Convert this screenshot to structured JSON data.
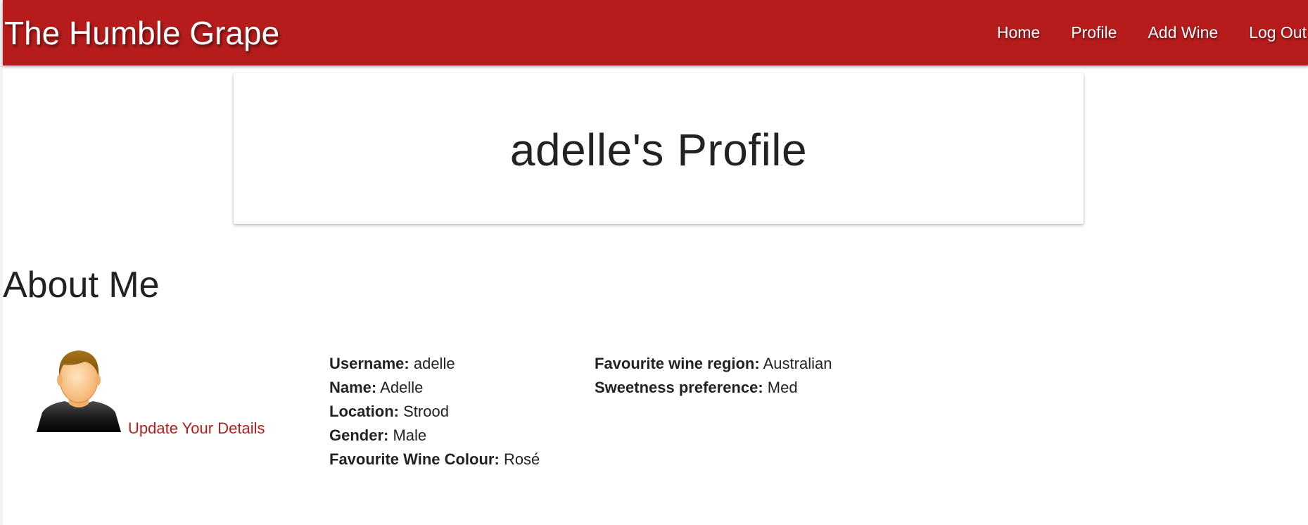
{
  "navbar": {
    "brand": "The Humble Grape",
    "links": [
      "Home",
      "Profile",
      "Add Wine",
      "Log Out"
    ]
  },
  "jumbotron": {
    "title": "adelle's Profile"
  },
  "about": {
    "title": "About Me",
    "update_link": "Update Your Details",
    "avatar_icon": "user-avatar-icon",
    "details_left": [
      {
        "label": "Username:",
        "value": "adelle"
      },
      {
        "label": "Name:",
        "value": "Adelle"
      },
      {
        "label": "Location:",
        "value": "Strood"
      },
      {
        "label": "Gender:",
        "value": "Male"
      },
      {
        "label": "Favourite Wine Colour:",
        "value": "Rosé"
      }
    ],
    "details_right": [
      {
        "label": "Favourite wine region:",
        "value": "Australian"
      },
      {
        "label": "Sweetness preference:",
        "value": "Med"
      }
    ]
  },
  "colors": {
    "brand_red": "#b71c1c",
    "text": "#222222"
  }
}
